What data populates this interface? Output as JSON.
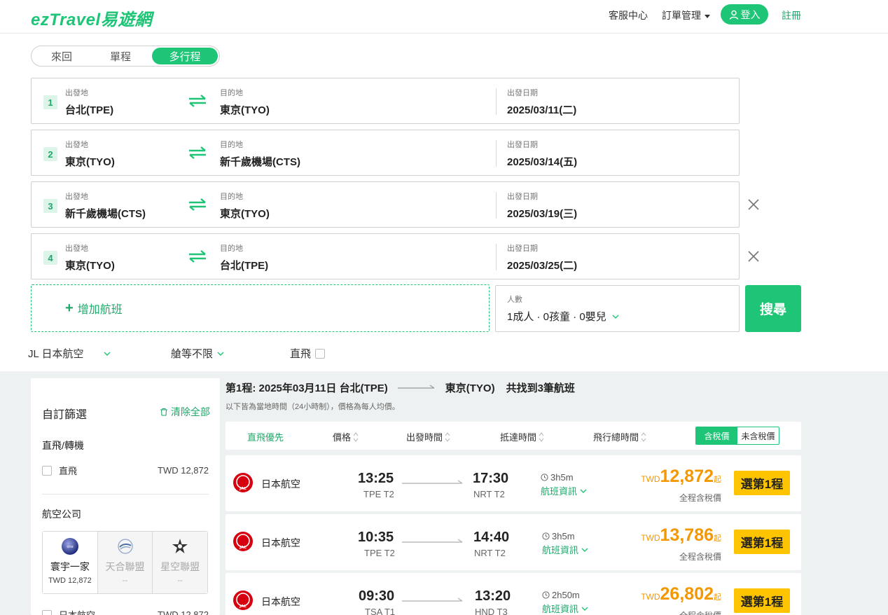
{
  "header": {
    "logo": "ezTravel易遊網",
    "service": "客服中心",
    "orders": "訂單管理",
    "login": "登入",
    "register": "註冊"
  },
  "trip_tabs": [
    "來回",
    "單程",
    "多行程"
  ],
  "labels": {
    "from": "出發地",
    "to": "目的地",
    "date": "出發日期",
    "pax": "人數"
  },
  "legs": [
    {
      "num": "1",
      "from": "台北(TPE)",
      "to": "東京(TYO)",
      "date": "2025/03/11(二)"
    },
    {
      "num": "2",
      "from": "東京(TYO)",
      "to": "新千歲機場(CTS)",
      "date": "2025/03/14(五)"
    },
    {
      "num": "3",
      "from": "新千歲機場(CTS)",
      "to": "東京(TYO)",
      "date": "2025/03/19(三)"
    },
    {
      "num": "4",
      "from": "東京(TYO)",
      "to": "台北(TPE)",
      "date": "2025/03/25(二)"
    }
  ],
  "add_leg": "增加航班",
  "pax_value": "1成人 · 0孩童 · 0嬰兒",
  "search_btn": "搜尋",
  "filters": {
    "airline": "JL 日本航空",
    "cabin": "艙等不限",
    "direct": "直飛"
  },
  "sidebar": {
    "title": "自訂篩選",
    "clear": "清除全部",
    "sec_direct": "直飛/轉機",
    "direct_label": "直飛",
    "direct_price": "TWD 12,872",
    "sec_airline": "航空公司",
    "alliances": [
      {
        "name": "寰宇一家",
        "price": "TWD 12,872"
      },
      {
        "name": "天合聯盟",
        "price": "--"
      },
      {
        "name": "星空聯盟",
        "price": "--"
      }
    ],
    "airline_label": "日本航空",
    "airline_price": "TWD 12,872"
  },
  "results": {
    "leg_prefix": "第1程: 2025年03月11日 台北(TPE)",
    "leg_dest": "東京(TYO)",
    "found": "共找到3筆航班",
    "note": "以下皆為當地時間（24小時制），價格為每人均價。",
    "sort": {
      "direct": "直飛優先",
      "price": "價格",
      "dep": "出發時間",
      "arr": "抵達時間",
      "total": "飛行總時間"
    },
    "tax_on": "含稅價",
    "tax_off": "未含稅價",
    "select": "選第1程",
    "currency": "TWD",
    "qi": "起",
    "price_note": "全程含稅價",
    "info": "航班資訊"
  },
  "flights": [
    {
      "airline": "日本航空",
      "dep": "13:25",
      "dep_t": "TPE T2",
      "arr": "17:30",
      "arr_t": "NRT T2",
      "dur": "3h5m",
      "price": "12,872"
    },
    {
      "airline": "日本航空",
      "dep": "10:35",
      "dep_t": "TPE T2",
      "arr": "14:40",
      "arr_t": "NRT T2",
      "dur": "3h5m",
      "price": "13,786"
    },
    {
      "airline": "日本航空",
      "dep": "09:30",
      "dep_t": "TSA T1",
      "arr": "13:20",
      "arr_t": "HND T3",
      "dur": "2h50m",
      "price": "26,802"
    }
  ],
  "colors": {
    "brand": "#1ec576",
    "price": "#f39800",
    "select": "#ffc400"
  }
}
